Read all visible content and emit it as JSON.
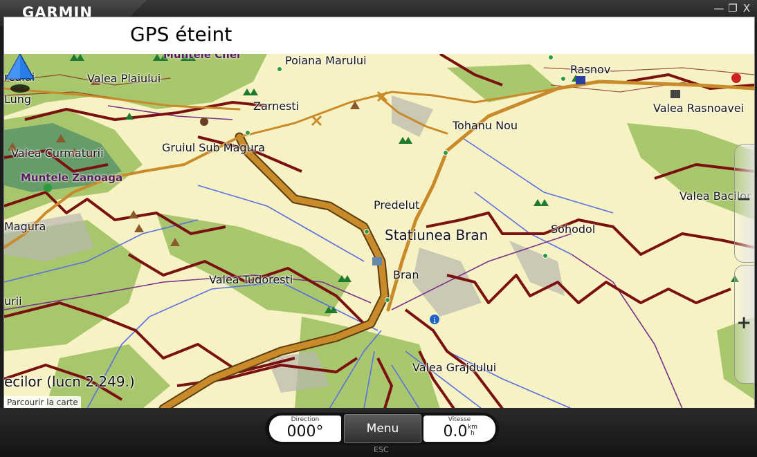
{
  "window": {
    "brand": "GARMIN",
    "brand_mark": "◤",
    "controls": {
      "minimize": "—",
      "restore": "❐",
      "close": "X"
    }
  },
  "header": {
    "title": "GPS éteint"
  },
  "map": {
    "labels": {
      "poiana_marului": "Poiana Marului",
      "rasnov": "Rasnov",
      "valea_plaiului": "Valea Plaiului",
      "rcului": "rcului",
      "lung": "Lung",
      "zarnesti": "Zarnesti",
      "valea_rasnoavei": "Valea Rasnoavei",
      "tohanu_nou": "Tohanu Nou",
      "valea_curmaturii": "Valea Curmaturii",
      "gruiul_sub_magura": "Gruiul Sub Magura",
      "muntele_zanoaga": "Muntele Zanoaga",
      "valea_bacilor": "Valea Bacilor",
      "predelut": "Predelut",
      "magura": "Magura",
      "sohodol": "Sohodol",
      "statiunea_bran": "Statiunea Bran",
      "bran": "Bran",
      "valea_tudoresti": "Valea Tudoresti",
      "urii": "urii",
      "valea_grajdului": "Valea Grajdului",
      "current_road": "ecilor (lucn 2.249.)",
      "partial_top": "Muntele Chel"
    },
    "browse_label": "Parcourir la carte",
    "zoom": {
      "minus": "−",
      "plus": "+"
    },
    "colors": {
      "land": "#f7f2c4",
      "forest": "#9bbf5d",
      "road": "#c98a2a",
      "contour": "#7a1010",
      "river": "#5a6ee8",
      "boundary": "#7a2f8a"
    }
  },
  "bottom": {
    "direction": {
      "label": "Direction",
      "value": "000°"
    },
    "menu_label": "Menu",
    "speed": {
      "label": "Vitesse",
      "value": "0.0",
      "unit_top": "km",
      "unit_bottom": "h"
    },
    "esc_label": "ESC"
  }
}
